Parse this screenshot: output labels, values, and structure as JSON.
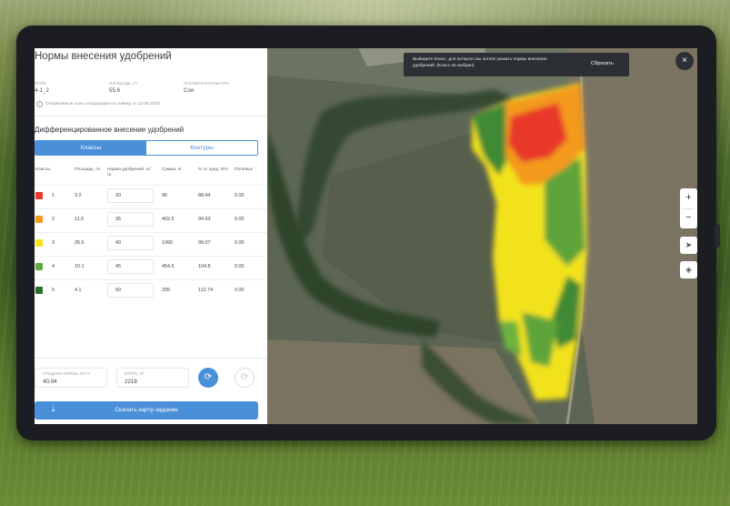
{
  "header": {
    "title": "Нормы внесения удобрений"
  },
  "field_info": [
    {
      "label": "ПОЛЕ",
      "value": "4-1_2"
    },
    {
      "label": "ПЛОЩАДЬ, ГА",
      "value": "55.6"
    },
    {
      "label": "ПОСЕВНАЯ КУЛЬТУРА",
      "value": "Соя"
    }
  ],
  "info_note": "Оперативные зоны плодородия по снимку от 13.09.2020",
  "section_title": "Дифференцированное внесение удобрений",
  "tabs": [
    {
      "label": "Классы",
      "active": true
    },
    {
      "label": "Контуры",
      "active": false
    }
  ],
  "table": {
    "headers": [
      "Классы",
      "Площадь, га",
      "Норма удобрений, кг/га",
      "Сумма, кг",
      "% от сред. NVI",
      "Полевые"
    ],
    "rows": [
      {
        "cls": "1",
        "color": "#e8392a",
        "area": "3.2",
        "rate": "30",
        "sum": "96",
        "pct": "88.44",
        "field": "0.00"
      },
      {
        "cls": "2",
        "color": "#f39a1f",
        "area": "11.5",
        "rate": "35",
        "sum": "402.5",
        "pct": "94.93",
        "field": "0.00"
      },
      {
        "cls": "3",
        "color": "#f5e51d",
        "area": "26.5",
        "rate": "40",
        "sum": "1060",
        "pct": "99.07",
        "field": "0.00"
      },
      {
        "cls": "4",
        "color": "#62a83c",
        "area": "10.1",
        "rate": "45",
        "sum": "454.5",
        "pct": "104.8",
        "field": "0.00"
      },
      {
        "cls": "5",
        "color": "#2a6e2e",
        "area": "4.1",
        "rate": "50",
        "sum": "205",
        "pct": "112.74",
        "field": "0.00"
      }
    ]
  },
  "summary": {
    "avg_label": "СРЕДНЯЯ НОРМА, КГ/ГА",
    "avg_value": "40.04",
    "total_label": "ИТОГО, КГ",
    "total_value": "2218"
  },
  "actions": {
    "refresh_icon": "refresh-icon",
    "download_label": "Скачать карту-задание",
    "download_icon": "download-icon"
  },
  "map": {
    "toast_text": "Выберите Класс, для которого вы хотите указать нормы внесения удобрений. (Класс не выбран)",
    "toast_button": "Сбросить",
    "close_icon": "×",
    "zoom_in": "+",
    "zoom_out": "−",
    "locate_icon": "navigation-arrow-icon",
    "layers_icon": "layers-icon"
  }
}
